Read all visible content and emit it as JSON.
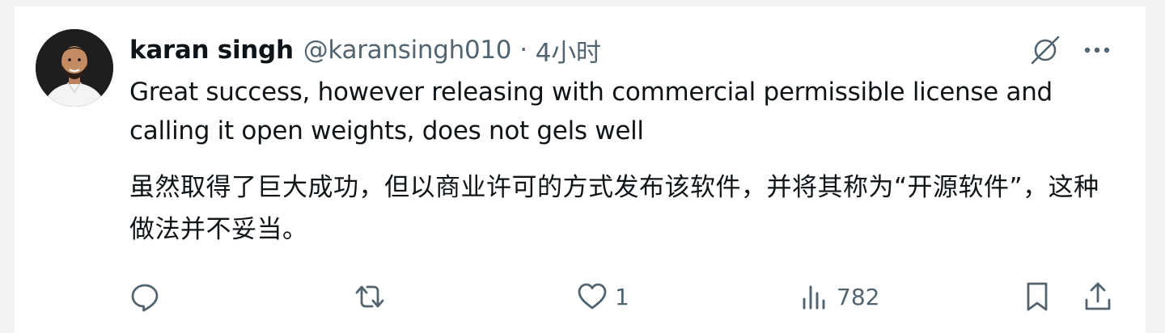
{
  "author": {
    "name": "karan singh",
    "handle": "@karansingh010",
    "separator": "·",
    "time": "4小时"
  },
  "tweet": {
    "text_en": "Great success, however releasing with commercial permissible license and calling it open weights, does not gels well",
    "text_zh": "虽然取得了巨大成功，但以商业许可的方式发布该软件，并将其称为“开源软件”，这种做法并不妥当。"
  },
  "actions": {
    "reply_icon": "reply-icon",
    "retweet_icon": "retweet-icon",
    "like_icon": "heart-icon",
    "like_count": "1",
    "views_icon": "views-icon",
    "views_count": "782",
    "bookmark_icon": "bookmark-icon",
    "share_icon": "share-icon"
  },
  "top_icons": {
    "grok": "grok-icon",
    "more": "more-icon"
  },
  "colors": {
    "text": "#0f1419",
    "secondary": "#536471",
    "background": "#ffffff",
    "page": "#f2f2f2"
  }
}
